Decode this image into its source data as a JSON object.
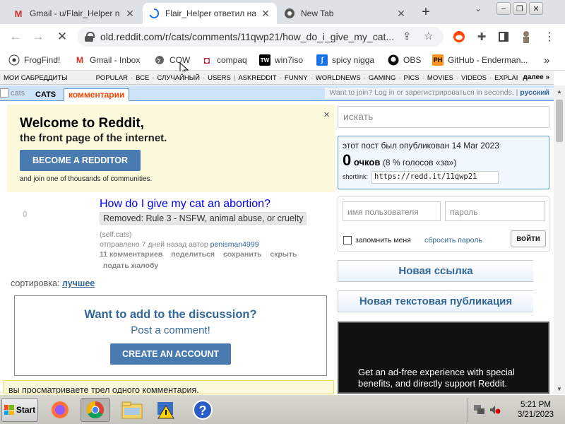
{
  "browser": {
    "tabs": [
      {
        "label": "Gmail - u/Flair_Helper n",
        "icon": "gmail-icon"
      },
      {
        "label": "Flair_Helper ответил на",
        "icon": "loading-icon",
        "active": true
      },
      {
        "label": "New Tab",
        "icon": "chrome-icon"
      }
    ],
    "url": "old.reddit.com/r/cats/comments/11qwp21/how_do_i_give_my_cat...",
    "bookmarks": [
      {
        "label": "FrogFind!",
        "icon": "frog-icon"
      },
      {
        "label": "Gmail - Inbox",
        "icon": "gmail-icon"
      },
      {
        "label": "COW",
        "icon": "globe-icon"
      },
      {
        "label": "compaq",
        "icon": "compaq-icon"
      },
      {
        "label": "win7iso",
        "icon": "win7iso-icon"
      },
      {
        "label": "spicy nigga",
        "icon": "spicy-icon"
      },
      {
        "label": "OBS",
        "icon": "github-icon"
      },
      {
        "label": "GitHub - Enderman...",
        "icon": "ph-icon"
      }
    ],
    "bookmarks_more": "»"
  },
  "reddit": {
    "srbar": {
      "my_subreddits": "мои сабреддиты",
      "items": [
        "popular",
        "все",
        "случайный",
        "users",
        "askreddit",
        "funny",
        "worldnews",
        "gaming",
        "pics",
        "movies",
        "videos",
        "explain"
      ],
      "more": "далее »"
    },
    "header": {
      "logo_alt": "cats",
      "subreddit": "cats",
      "tab": "комментарии",
      "join_text": "Want to join? Log in or зарегистрироваться in seconds.",
      "language": "русский"
    },
    "welcome": {
      "title": "Welcome to Reddit,",
      "subtitle": "the front page of the internet.",
      "button": "BECOME A REDDITOR",
      "join": "and join one of thousands of communities.",
      "close": "×"
    },
    "post": {
      "score": "0",
      "title": "How do I give my cat an abortion?",
      "flair": "Removed: Rule 3 - NSFW, animal abuse, or cruelty",
      "domain": "(self.cats)",
      "tagline_prefix": "отправлено 7 дней назад автор",
      "author": "penisman4999",
      "buttons": [
        "11 комментариев",
        "поделиться",
        "сохранить",
        "скрыть"
      ],
      "report": "подать жалобу"
    },
    "sort": {
      "label": "сортировка:",
      "value": "лучшее"
    },
    "discussion": {
      "title": "Want to add to the discussion?",
      "subtitle": "Post a comment!",
      "button": "CREATE AN ACCOUNT"
    },
    "info_bar": "вы просматриваете трел одного комментария.",
    "sidebar": {
      "search_placeholder": "искать",
      "posted": "этот пост был опубликован 14 Mar 2023",
      "score_number": "0",
      "score_word": "очков",
      "score_pct": "(8 % голосов «за»)",
      "shortlink_label": "shortlink:",
      "shortlink": "https://redd.it/11qwp21",
      "username_placeholder": "имя пользователя",
      "password_placeholder": "пароль",
      "remember": "запомнить меня",
      "reset": "сбросить пароль",
      "login_button": "войти",
      "new_link": "Новая ссылка",
      "new_text": "Новая текстовая публикация",
      "gold_text": "Get an ad-free experience with special benefits, and directly support Reddit."
    }
  },
  "taskbar": {
    "start": "Start",
    "time": "5:21 PM",
    "date": "3/21/2023"
  }
}
